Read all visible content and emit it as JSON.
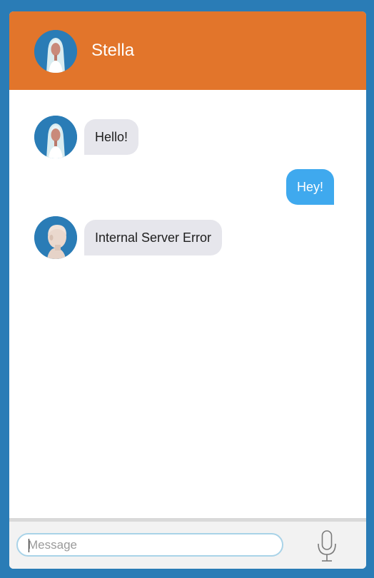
{
  "header": {
    "title": "Stella",
    "avatar": "stella-avatar"
  },
  "messages": [
    {
      "side": "incoming",
      "sender_avatar": "stella-avatar",
      "text": "Hello!"
    },
    {
      "side": "outgoing",
      "text": "Hey!"
    },
    {
      "side": "incoming",
      "sender_avatar": "bald-avatar",
      "text": "Internal Server Error"
    }
  ],
  "composer": {
    "placeholder": "Message",
    "value": "",
    "mic_icon": "microphone-icon"
  },
  "colors": {
    "background": "#2a7cb6",
    "header": "#e2752b",
    "incoming_bubble": "#e6e6ec",
    "outgoing_bubble": "#3fa9ee",
    "input_border": "#a9d3e8"
  }
}
